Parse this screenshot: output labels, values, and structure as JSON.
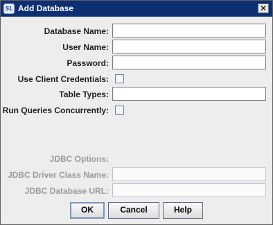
{
  "window": {
    "title": "Add Database",
    "icon_text": "SL",
    "close_glyph": "✕"
  },
  "form": {
    "database_name": {
      "label": "Database Name:",
      "value": ""
    },
    "user_name": {
      "label": "User Name:",
      "value": ""
    },
    "password": {
      "label": "Password:",
      "value": ""
    },
    "use_client_credentials": {
      "label": "Use Client Credentials:",
      "checked": false
    },
    "table_types": {
      "label": "Table Types:",
      "value": ""
    },
    "run_queries_concurrently": {
      "label": "Run Queries Concurrently:",
      "checked": false
    },
    "jdbc_options": {
      "label": "JDBC Options:"
    },
    "jdbc_driver_class_name": {
      "label": "JDBC Driver Class Name:",
      "value": ""
    },
    "jdbc_database_url": {
      "label": "JDBC Database URL:",
      "value": ""
    }
  },
  "buttons": {
    "ok": "OK",
    "cancel": "Cancel",
    "help": "Help"
  },
  "colors": {
    "titlebar": "#0d2f74",
    "dialog_bg": "#ededed",
    "disabled_text": "#9a9a9a"
  }
}
